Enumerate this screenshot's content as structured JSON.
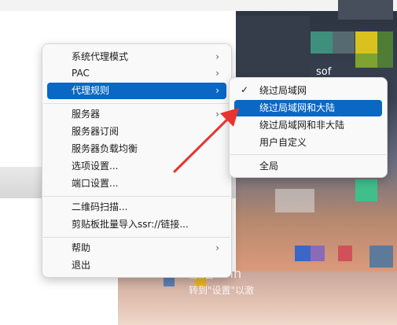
{
  "main_menu": {
    "items": [
      {
        "label": "系统代理模式",
        "has_submenu": true
      },
      {
        "label": "PAC",
        "has_submenu": true
      },
      {
        "label": "代理规则",
        "has_submenu": true,
        "highlighted": true
      },
      {
        "label": "服务器",
        "has_submenu": true
      },
      {
        "label": "服务器订阅",
        "has_submenu": false
      },
      {
        "label": "服务器负载均衡",
        "has_submenu": false
      },
      {
        "label": "选项设置...",
        "has_submenu": false
      },
      {
        "label": "端口设置...",
        "has_submenu": false
      },
      {
        "label": "二维码扫描...",
        "has_submenu": false
      },
      {
        "label": "剪贴板批量导入ssr://链接...",
        "has_submenu": false
      },
      {
        "label": "帮助",
        "has_submenu": true
      },
      {
        "label": "退出",
        "has_submenu": false
      }
    ]
  },
  "sub_menu": {
    "items": [
      {
        "label": "绕过局域网",
        "checked": true
      },
      {
        "label": "绕过局域网和大陆",
        "checked": false,
        "highlighted": true
      },
      {
        "label": "绕过局域网和非大陆",
        "checked": false
      },
      {
        "label": "用户自定义",
        "checked": false
      },
      {
        "label": "全局",
        "checked": false
      }
    ]
  },
  "icons": {
    "submenu_arrow": "chevron-right-icon",
    "checkmark": "checkmark-icon",
    "annotation": "red-arrow-annotation"
  },
  "desktop": {
    "watermark_line1": "激活 Win",
    "watermark_line2": "转到\"设置\"以激",
    "partial_text": "sof"
  },
  "colors": {
    "highlight": "#0a67c4",
    "annotation_red": "#e8332e",
    "menu_bg": "#f9f9f9"
  }
}
